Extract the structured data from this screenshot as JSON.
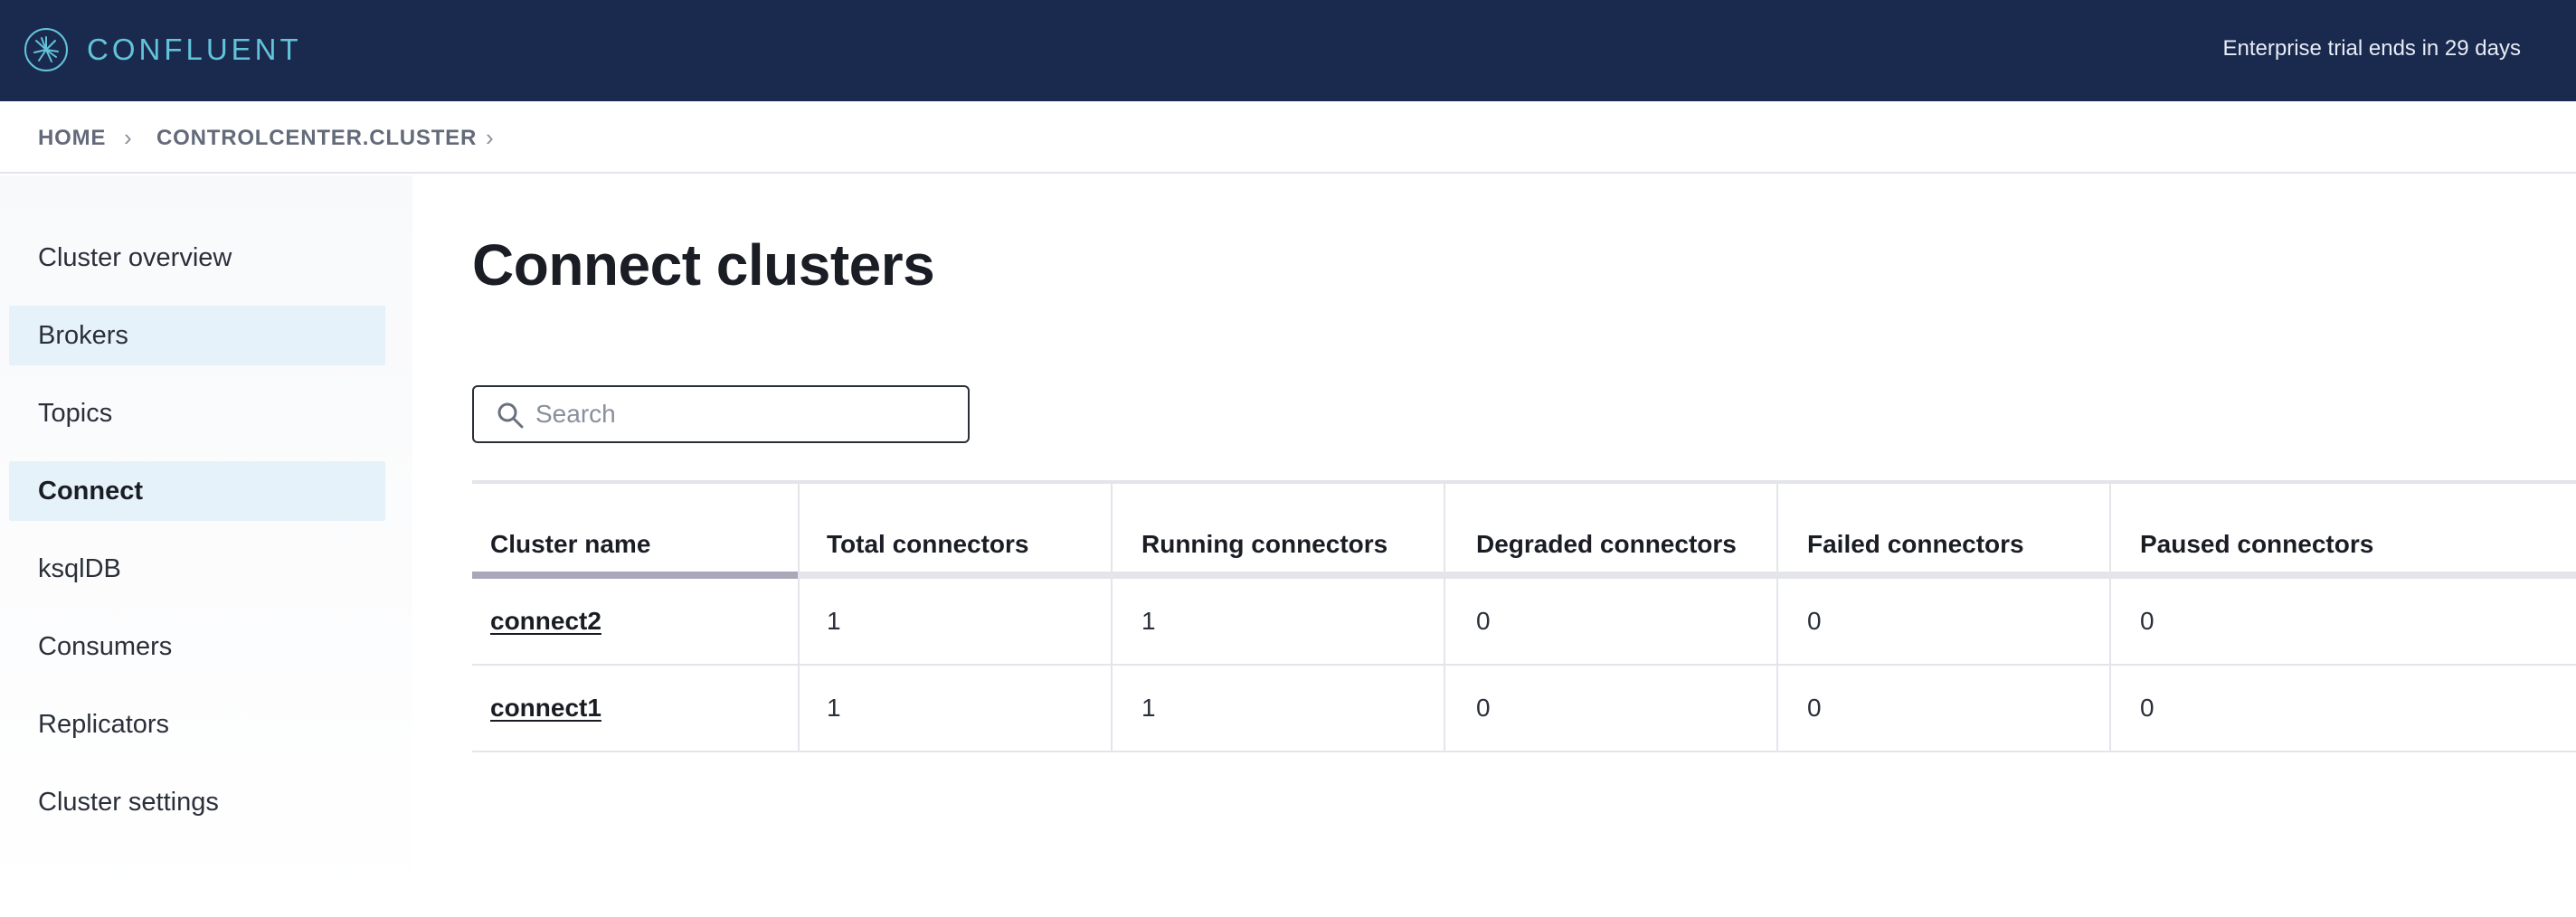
{
  "header": {
    "brand": "CONFLUENT",
    "trial_notice": "Enterprise trial ends in 29 days",
    "logo_icon": "confluent-starburst-icon"
  },
  "breadcrumb": {
    "items": [
      "HOME",
      "CONTROLCENTER.CLUSTER"
    ],
    "separator_icon": "chevron-right-icon"
  },
  "sidebar": {
    "items": [
      {
        "label": "Cluster overview",
        "state": "normal"
      },
      {
        "label": "Brokers",
        "state": "highlighted"
      },
      {
        "label": "Topics",
        "state": "normal"
      },
      {
        "label": "Connect",
        "state": "active"
      },
      {
        "label": "ksqlDB",
        "state": "normal"
      },
      {
        "label": "Consumers",
        "state": "normal"
      },
      {
        "label": "Replicators",
        "state": "normal"
      },
      {
        "label": "Cluster settings",
        "state": "normal"
      }
    ]
  },
  "main": {
    "title": "Connect clusters",
    "search": {
      "placeholder": "Search",
      "value": ""
    },
    "table": {
      "columns": [
        "Cluster name",
        "Total connectors",
        "Running connectors",
        "Degraded connectors",
        "Failed connectors",
        "Paused connectors"
      ],
      "sorted_column": "Cluster name",
      "rows": [
        {
          "name": "connect2",
          "total": "1",
          "running": "1",
          "degraded": "0",
          "failed": "0",
          "paused": "0"
        },
        {
          "name": "connect1",
          "total": "1",
          "running": "1",
          "degraded": "0",
          "failed": "0",
          "paused": "0"
        }
      ]
    }
  },
  "colors": {
    "topbar_bg": "#1a2a4f",
    "brand_accent": "#63c3d8",
    "nav_highlight": "#e6f2f9",
    "sort_indicator": "#a9a7b8"
  }
}
